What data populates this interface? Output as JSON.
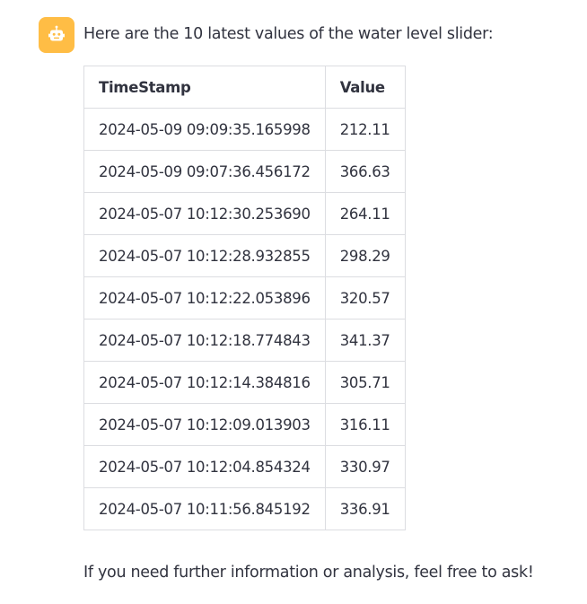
{
  "message": {
    "avatar_icon": "bot-icon",
    "avatar_color": "#ffbd45",
    "intro": "Here are the 10 latest values of the water level slider:",
    "outro": "If you need further information or analysis, feel free to ask!"
  },
  "table": {
    "headers": {
      "timestamp": "TimeStamp",
      "value": "Value"
    },
    "rows": [
      {
        "timestamp": "2024-05-09 09:09:35.165998",
        "value": "212.11"
      },
      {
        "timestamp": "2024-05-09 09:07:36.456172",
        "value": "366.63"
      },
      {
        "timestamp": "2024-05-07 10:12:30.253690",
        "value": "264.11"
      },
      {
        "timestamp": "2024-05-07 10:12:28.932855",
        "value": "298.29"
      },
      {
        "timestamp": "2024-05-07 10:12:22.053896",
        "value": "320.57"
      },
      {
        "timestamp": "2024-05-07 10:12:18.774843",
        "value": "341.37"
      },
      {
        "timestamp": "2024-05-07 10:12:14.384816",
        "value": "305.71"
      },
      {
        "timestamp": "2024-05-07 10:12:09.013903",
        "value": "316.11"
      },
      {
        "timestamp": "2024-05-07 10:12:04.854324",
        "value": "330.97"
      },
      {
        "timestamp": "2024-05-07 10:11:56.845192",
        "value": "336.91"
      }
    ]
  }
}
